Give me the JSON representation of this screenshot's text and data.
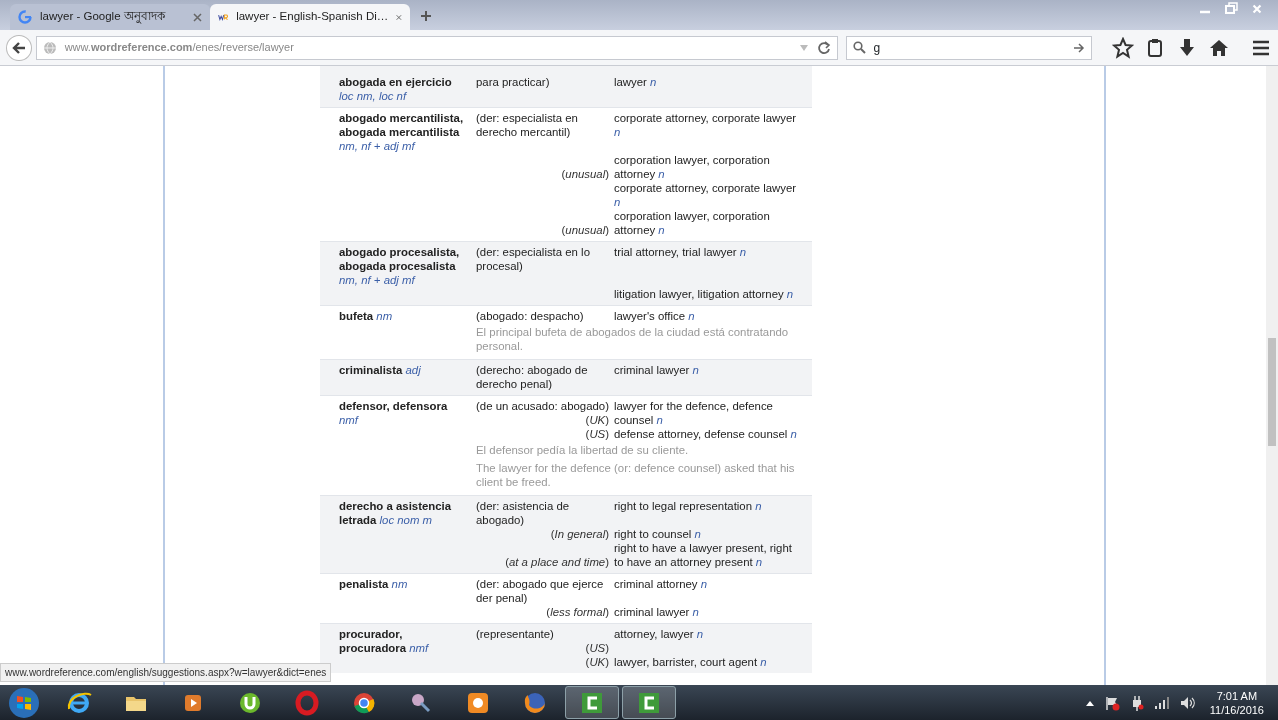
{
  "browser": {
    "tabs": [
      {
        "title": "lawyer - Google অনুবাদক",
        "kind": "google",
        "selected": false
      },
      {
        "title": "lawyer - English-Spanish Di…",
        "kind": "site",
        "selected": true
      }
    ],
    "address": "www.**wordreference.com**/enes/reverse/lawyer",
    "search": {
      "value": "g"
    }
  },
  "entries": [
    {
      "shaded": true,
      "lines": [
        {
          "term": "abogada en ejercicio",
          "pos": "loc nm, loc nf",
          "sense": "para practicar)",
          "translation": "lawyer",
          "tpos": "n"
        }
      ]
    },
    {
      "shaded": false,
      "lines": [
        {
          "term": "abogado mercantilista, abogada mercantilista",
          "pos": "nm, nf + adj mf",
          "sense": "(der: especialista en derecho mercantil)",
          "translation": "corporate attorney, corporate lawyer",
          "tpos": "n"
        },
        {
          "note": "(*unusual*)",
          "translation": "corporation lawyer, corporation attorney",
          "tpos": "n"
        },
        {
          "translation": "corporate attorney, corporate lawyer",
          "tpos": "n"
        },
        {
          "note": "(*unusual*)",
          "translation": "corporation lawyer, corporation attorney",
          "tpos": "n"
        }
      ]
    },
    {
      "shaded": true,
      "lines": [
        {
          "term": "abogado procesalista, abogada procesalista",
          "pos": "nm, nf + adj mf",
          "sense": "(der: especialista en lo procesal)",
          "translation": "trial attorney, trial lawyer",
          "tpos": "n"
        },
        {
          "translation": "litigation lawyer, litigation attorney",
          "tpos": "n"
        }
      ]
    },
    {
      "shaded": false,
      "lines": [
        {
          "term": "bufeta",
          "pos": "nm",
          "sense": "(abogado: despacho)",
          "translation": "lawyer's office",
          "tpos": "n"
        },
        {
          "example": "El principal bufeta de abogados de la ciudad está contratando personal."
        }
      ]
    },
    {
      "shaded": true,
      "lines": [
        {
          "term": "criminalista",
          "pos": "adj",
          "sense": "(derecho: abogado de derecho penal)",
          "translation": "criminal lawyer",
          "tpos": "n"
        }
      ]
    },
    {
      "shaded": false,
      "lines": [
        {
          "term": "defensor, defensora",
          "pos": "nmf",
          "sense": "(de un acusado: abogado)",
          "note": "(*UK*)",
          "translation": "lawyer for the defence, defence counsel",
          "tpos": "n"
        },
        {
          "note": "(*US*)",
          "translation": "defense attorney, defense counsel",
          "tpos": "n"
        },
        {
          "example": "El defensor pedía la libertad de su cliente."
        },
        {
          "example": "The lawyer for the defence (or: defence counsel) asked that his client be freed."
        }
      ]
    },
    {
      "shaded": true,
      "lines": [
        {
          "term": "derecho a asistencia letrada",
          "pos": "loc nom m",
          "sense": "(der: asistencia de abogado)",
          "translation": "right to legal representation",
          "tpos": "n"
        },
        {
          "note": "(*In general*)",
          "translation": "right to counsel",
          "tpos": "n"
        },
        {
          "note": "(*at a place and time*)",
          "translation": "right to have a lawyer present, right to have an attorney present",
          "tpos": "n"
        }
      ]
    },
    {
      "shaded": false,
      "lines": [
        {
          "term": "penalista",
          "pos": "nm",
          "sense": "(der: abogado que ejerce der penal)",
          "translation": "criminal attorney",
          "tpos": "n"
        },
        {
          "note": "(*less formal*)",
          "translation": "criminal lawyer",
          "tpos": "n"
        }
      ]
    },
    {
      "shaded": true,
      "lines": [
        {
          "term": "procurador, procuradora",
          "pos": "nmf",
          "sense": "(representante)",
          "note": "(*US*)",
          "translation": "attorney, lawyer",
          "tpos": "n"
        },
        {
          "note": "(*UK*)",
          "translation": "lawyer, barrister, court agent",
          "tpos": "n"
        }
      ]
    }
  ],
  "status_link": "www.wordreference.com/english/suggestions.aspx?w=lawyer&dict=enes",
  "taskbar": {
    "apps": [
      {
        "kind": "ie",
        "active": false
      },
      {
        "kind": "folder",
        "active": false
      },
      {
        "kind": "media",
        "active": false
      },
      {
        "kind": "torrent",
        "active": false
      },
      {
        "kind": "opera",
        "active": false
      },
      {
        "kind": "chrome",
        "active": false
      },
      {
        "kind": "tool",
        "active": false
      },
      {
        "kind": "squirrel",
        "active": false
      },
      {
        "kind": "firefox",
        "active": false
      },
      {
        "kind": "camtasia",
        "active": true
      },
      {
        "kind": "camtasia",
        "active": true
      }
    ],
    "time": "7:01 AM",
    "date": "11/16/2016"
  }
}
